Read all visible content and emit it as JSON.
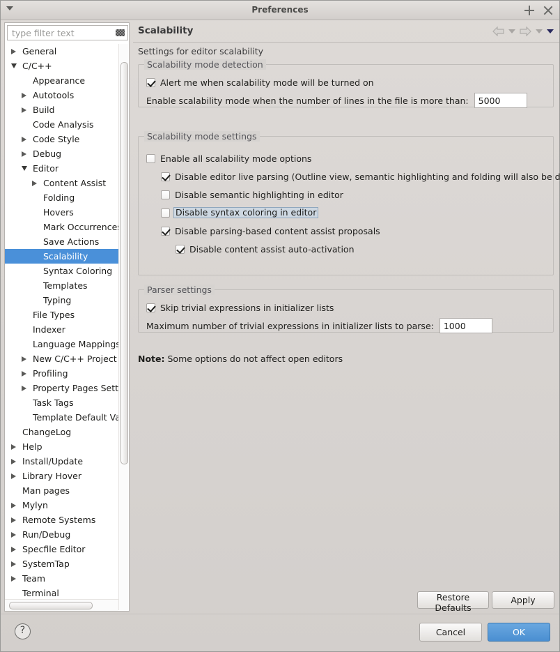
{
  "window": {
    "title": "Preferences",
    "menu_icon": "triangle-down-icon",
    "maximize_label": "+",
    "close_label": "×"
  },
  "sidebar": {
    "filter": {
      "placeholder": "type filter text",
      "value": "",
      "clear_icon": "clear-filter-icon"
    },
    "items": [
      {
        "label": "General",
        "depth": 0,
        "arrow": "collapsed",
        "selected": false
      },
      {
        "label": "C/C++",
        "depth": 0,
        "arrow": "expanded",
        "selected": false
      },
      {
        "label": "Appearance",
        "depth": 1,
        "arrow": "none",
        "selected": false
      },
      {
        "label": "Autotools",
        "depth": 1,
        "arrow": "collapsed",
        "selected": false
      },
      {
        "label": "Build",
        "depth": 1,
        "arrow": "collapsed",
        "selected": false
      },
      {
        "label": "Code Analysis",
        "depth": 1,
        "arrow": "none",
        "selected": false
      },
      {
        "label": "Code Style",
        "depth": 1,
        "arrow": "collapsed",
        "selected": false
      },
      {
        "label": "Debug",
        "depth": 1,
        "arrow": "collapsed",
        "selected": false
      },
      {
        "label": "Editor",
        "depth": 1,
        "arrow": "expanded",
        "selected": false
      },
      {
        "label": "Content Assist",
        "depth": 2,
        "arrow": "collapsed",
        "selected": false
      },
      {
        "label": "Folding",
        "depth": 2,
        "arrow": "none",
        "selected": false
      },
      {
        "label": "Hovers",
        "depth": 2,
        "arrow": "none",
        "selected": false
      },
      {
        "label": "Mark Occurrences",
        "depth": 2,
        "arrow": "none",
        "selected": false
      },
      {
        "label": "Save Actions",
        "depth": 2,
        "arrow": "none",
        "selected": false
      },
      {
        "label": "Scalability",
        "depth": 2,
        "arrow": "none",
        "selected": true
      },
      {
        "label": "Syntax Coloring",
        "depth": 2,
        "arrow": "none",
        "selected": false
      },
      {
        "label": "Templates",
        "depth": 2,
        "arrow": "none",
        "selected": false
      },
      {
        "label": "Typing",
        "depth": 2,
        "arrow": "none",
        "selected": false
      },
      {
        "label": "File Types",
        "depth": 1,
        "arrow": "none",
        "selected": false
      },
      {
        "label": "Indexer",
        "depth": 1,
        "arrow": "none",
        "selected": false
      },
      {
        "label": "Language Mappings",
        "depth": 1,
        "arrow": "none",
        "selected": false
      },
      {
        "label": "New C/C++ Project W",
        "depth": 1,
        "arrow": "collapsed",
        "selected": false
      },
      {
        "label": "Profiling",
        "depth": 1,
        "arrow": "collapsed",
        "selected": false
      },
      {
        "label": "Property Pages Settin",
        "depth": 1,
        "arrow": "collapsed",
        "selected": false
      },
      {
        "label": "Task Tags",
        "depth": 1,
        "arrow": "none",
        "selected": false
      },
      {
        "label": "Template Default Valu",
        "depth": 1,
        "arrow": "none",
        "selected": false
      },
      {
        "label": "ChangeLog",
        "depth": 0,
        "arrow": "none",
        "selected": false
      },
      {
        "label": "Help",
        "depth": 0,
        "arrow": "collapsed",
        "selected": false
      },
      {
        "label": "Install/Update",
        "depth": 0,
        "arrow": "collapsed",
        "selected": false
      },
      {
        "label": "Library Hover",
        "depth": 0,
        "arrow": "collapsed",
        "selected": false
      },
      {
        "label": "Man pages",
        "depth": 0,
        "arrow": "none",
        "selected": false
      },
      {
        "label": "Mylyn",
        "depth": 0,
        "arrow": "collapsed",
        "selected": false
      },
      {
        "label": "Remote Systems",
        "depth": 0,
        "arrow": "collapsed",
        "selected": false
      },
      {
        "label": "Run/Debug",
        "depth": 0,
        "arrow": "collapsed",
        "selected": false
      },
      {
        "label": "Specfile Editor",
        "depth": 0,
        "arrow": "collapsed",
        "selected": false
      },
      {
        "label": "SystemTap",
        "depth": 0,
        "arrow": "collapsed",
        "selected": false
      },
      {
        "label": "Team",
        "depth": 0,
        "arrow": "collapsed",
        "selected": false
      },
      {
        "label": "Terminal",
        "depth": 0,
        "arrow": "none",
        "selected": false
      }
    ]
  },
  "page": {
    "title": "Scalability",
    "subtitle": "Settings for editor scalability",
    "nav": {
      "back_icon": "arrow-left-icon",
      "back_menu_icon": "chevron-down-icon",
      "forward_icon": "arrow-right-icon",
      "forward_menu_icon": "chevron-down-icon",
      "view_menu_icon": "chevron-down-icon"
    },
    "groups": {
      "detection": {
        "title": "Scalability mode detection",
        "alert_checkbox": {
          "label": "Alert me when scalability mode will be turned on",
          "checked": true
        },
        "lines_field": {
          "label": "Enable scalability mode when the number of lines in the file is more than:",
          "value": "5000"
        }
      },
      "mode_settings": {
        "title": "Scalability mode settings",
        "options": [
          {
            "label": "Enable all scalability mode options",
            "checked": false
          },
          {
            "label": "Disable editor live parsing (Outline view, semantic highlighting and folding will also be disabled)",
            "checked": true
          },
          {
            "label": "Disable semantic highlighting in editor",
            "checked": false
          },
          {
            "label": "Disable syntax coloring in editor",
            "checked": false,
            "focused": true
          },
          {
            "label": "Disable parsing-based content assist proposals",
            "checked": true
          },
          {
            "label": "Disable content assist auto-activation",
            "checked": true
          }
        ]
      },
      "parser": {
        "title": "Parser settings",
        "skip_checkbox": {
          "label": "Skip trivial expressions in initializer lists",
          "checked": true
        },
        "max_field": {
          "label": "Maximum number of trivial expressions in initializer lists to parse:",
          "value": "1000"
        }
      }
    },
    "note_prefix": "Note:",
    "note_text": "Some options do not affect open editors",
    "restore_defaults_label": "Restore Defaults",
    "apply_label": "Apply"
  },
  "footer": {
    "help_icon": "question-mark-icon",
    "cancel_label": "Cancel",
    "ok_label": "OK"
  },
  "colors": {
    "selection_blue": "#4a90d9",
    "primary_button": "#4a8fd1",
    "window_bg": "#d6d3d0"
  }
}
